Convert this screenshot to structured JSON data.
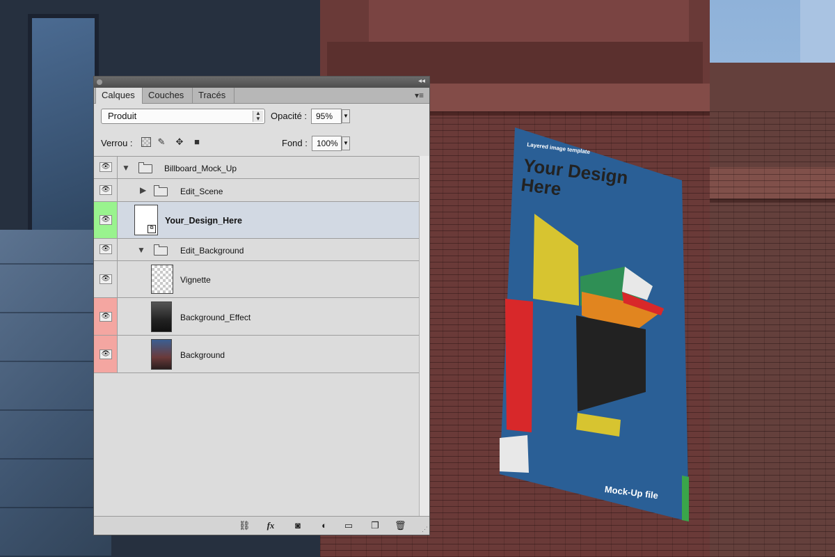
{
  "panel": {
    "tabs": [
      {
        "label": "Calques",
        "active": true
      },
      {
        "label": "Couches",
        "active": false
      },
      {
        "label": "Tracés",
        "active": false
      }
    ],
    "blend_mode": "Produit",
    "opacity_label": "Opacité :",
    "opacity_value": "95%",
    "lock_label": "Verrou :",
    "fill_label": "Fond :",
    "fill_value": "100%",
    "layers": [
      {
        "name": "Billboard_Mock_Up",
        "type": "group",
        "expanded": true,
        "color_tag": null
      },
      {
        "name": "Edit_Scene",
        "type": "group",
        "expanded": false,
        "color_tag": null
      },
      {
        "name": "Your_Design_Here",
        "type": "smart-object",
        "selected": true,
        "color_tag": "#99f38e"
      },
      {
        "name": "Edit_Background",
        "type": "group",
        "expanded": true,
        "color_tag": null
      },
      {
        "name": "Vignette",
        "type": "layer",
        "color_tag": null
      },
      {
        "name": "Background_Effect",
        "type": "layer",
        "color_tag": "#f4a6a1"
      },
      {
        "name": "Background",
        "type": "layer",
        "color_tag": "#f4a6a1"
      }
    ],
    "footer_icons": [
      "link-icon",
      "fx-icon",
      "mask-icon",
      "adjustment-icon",
      "new-group-icon",
      "new-layer-icon",
      "trash-icon"
    ]
  },
  "billboard": {
    "small_text": "Layered image template",
    "title": "Your Design Here",
    "footer_text": "Mock-Up file"
  },
  "colors": {
    "billboard_blue": "#2a5f96",
    "tag_green": "#99f38e",
    "tag_red": "#f4a6a1"
  }
}
